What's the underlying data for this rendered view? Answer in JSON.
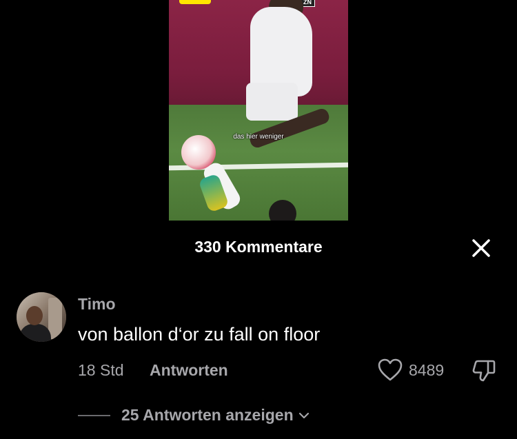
{
  "video": {
    "caption": "das hier weniger",
    "badge": "ZN"
  },
  "comments_panel": {
    "title": "330 Kommentare",
    "close_icon": "close-icon"
  },
  "comment": {
    "username": "Timo",
    "text": "von ballon d‘or zu fall on floor",
    "time": "18 Std",
    "reply_label": "Antworten",
    "like_count": "8489",
    "like_icon": "heart-icon",
    "dislike_icon": "thumbs-down-icon",
    "view_replies_label": "25 Antworten anzeigen",
    "view_replies_icon": "chevron-down-icon"
  },
  "colors": {
    "background": "#000000",
    "text_primary": "#ffffff",
    "text_secondary": "#a7a7ab"
  }
}
